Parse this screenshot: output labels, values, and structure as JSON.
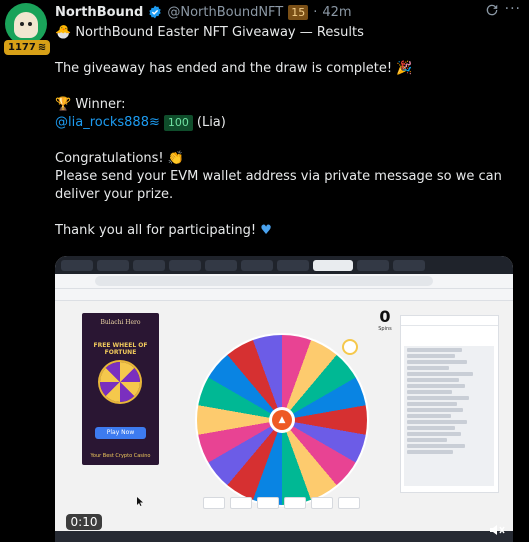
{
  "author": {
    "name": "NorthBound",
    "handle": "@NorthBoundNFT",
    "level": "15",
    "time": "42m",
    "badge_count": "1177"
  },
  "post": {
    "title": "NorthBound Easter NFT Giveaway — Results",
    "line1": "The giveaway has ended and the draw is complete!",
    "winner_label": "Winner:",
    "winner_handle": "@lia_rocks888",
    "winner_level": "100",
    "winner_name": "(Lia)",
    "congrats": "Congratulations!",
    "instructions": "Please send your EVM wallet address via private message so we can deliver your prize.",
    "thanks": "Thank you all for participating!"
  },
  "media": {
    "duration": "0:10",
    "ad": {
      "brand": "Bulachi Hero",
      "headline": "FREE WHEEL OF FORTUNE",
      "button": "Play Now",
      "footer": "Your Best Crypto Casino"
    },
    "spin_count": "0",
    "spin_label": "Spins"
  },
  "icons": {
    "verified": "verified-badge-icon",
    "refresh": "refresh-icon",
    "more": "more-icon",
    "volume": "volume-icon"
  },
  "colors": {
    "accent": "#1d9bf0",
    "background": "#000000"
  }
}
